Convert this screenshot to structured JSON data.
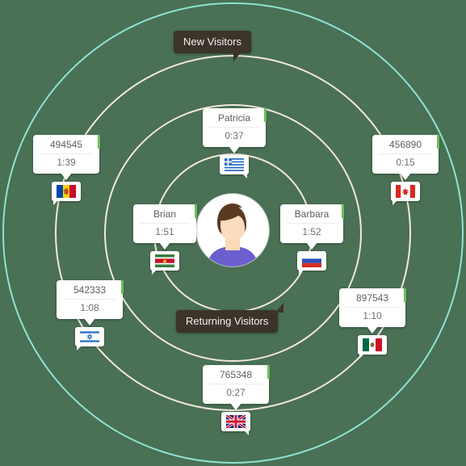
{
  "background_color": "#4a7055",
  "rings": [
    {
      "name": "ring-outer-accent",
      "color": "#8fe3d2",
      "diameter": 570
    },
    {
      "name": "ring-3",
      "color": "#f2e7df",
      "diameter": 440
    },
    {
      "name": "ring-2",
      "color": "#f2e7df",
      "diameter": 318
    },
    {
      "name": "ring-1",
      "color": "#f2e7df",
      "diameter": 196
    }
  ],
  "center": {
    "name": "center-avatar",
    "description": "user-avatar"
  },
  "tooltips": {
    "new_visitors": "New Visitors",
    "returning_visitors": "Returning Visitors",
    "color": "#3b342b"
  },
  "accent_color": "#6dbf57",
  "nodes": [
    {
      "id": "patricia",
      "label": "Patricia",
      "time": "0:37",
      "flag": "greece-flag",
      "flag_name": "Greece"
    },
    {
      "id": "brian",
      "label": "Brian",
      "time": "1:51",
      "flag": "suriname-flag",
      "flag_name": "Suriname"
    },
    {
      "id": "barbara",
      "label": "Barbara",
      "time": "1:52",
      "flag": "russia-flag",
      "flag_name": "Russia"
    },
    {
      "id": "n494545",
      "label": "494545",
      "time": "1:39",
      "flag": "moldova-flag",
      "flag_name": "Moldova"
    },
    {
      "id": "n456890",
      "label": "456890",
      "time": "0:15",
      "flag": "canada-flag",
      "flag_name": "Canada"
    },
    {
      "id": "n542333",
      "label": "542333",
      "time": "1:08",
      "flag": "israel-flag",
      "flag_name": "Israel"
    },
    {
      "id": "n897543",
      "label": "897543",
      "time": "1:10",
      "flag": "mexico-flag",
      "flag_name": "Mexico"
    },
    {
      "id": "n765348",
      "label": "765348",
      "time": "0:27",
      "flag": "uk-flag",
      "flag_name": "United Kingdom"
    }
  ]
}
